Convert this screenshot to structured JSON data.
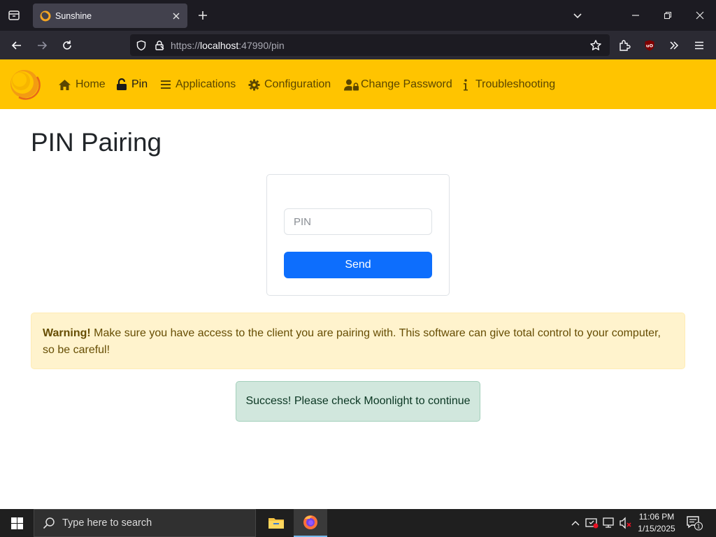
{
  "browser": {
    "tab_title": "Sunshine",
    "url_prefix": "https://",
    "url_host": "localhost",
    "url_rest": ":47990/pin"
  },
  "nav": {
    "items": [
      {
        "label": "Home",
        "icon": "home-icon"
      },
      {
        "label": "Pin",
        "icon": "unlock-icon",
        "active": true
      },
      {
        "label": "Applications",
        "icon": "list-icon"
      },
      {
        "label": "Configuration",
        "icon": "gear-icon"
      },
      {
        "label": "Change Password",
        "icon": "user-lock-icon"
      },
      {
        "label": "Troubleshooting",
        "icon": "info-icon"
      }
    ],
    "accent_color": "#ffc400"
  },
  "page": {
    "title": "PIN Pairing",
    "pin_placeholder": "PIN",
    "pin_value": "",
    "send_label": "Send",
    "warning_strong": "Warning!",
    "warning_text": " Make sure you have access to the client you are pairing with. This software can give total control to your computer, so be careful!",
    "success_text": "Success! Please check Moonlight to continue"
  },
  "taskbar": {
    "search_placeholder": "Type here to search",
    "time": "11:06 PM",
    "date": "1/15/2025",
    "notification_count": "1"
  }
}
